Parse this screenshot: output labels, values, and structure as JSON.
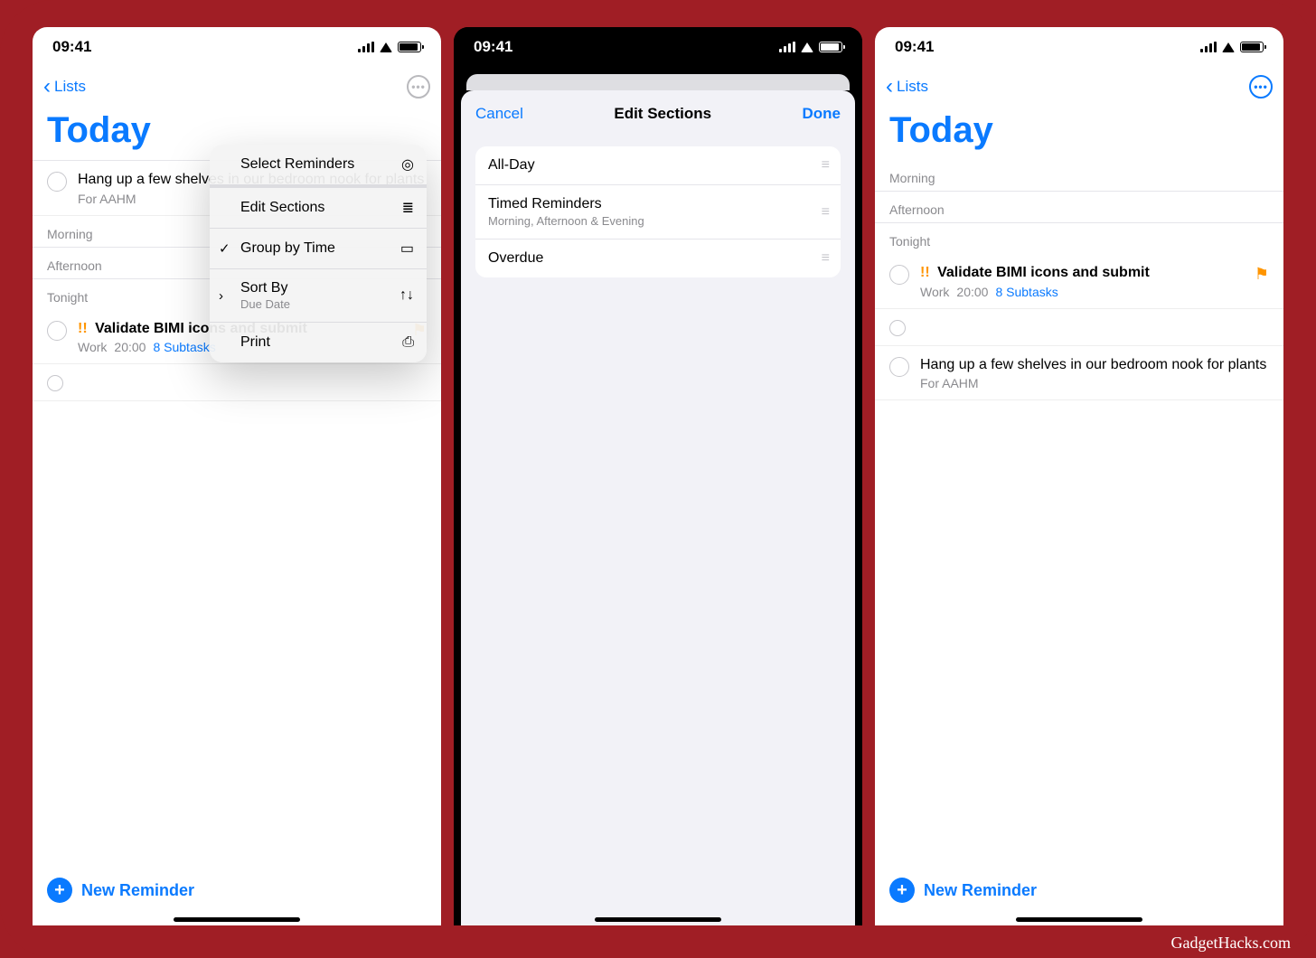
{
  "credit": "GadgetHacks.com",
  "status": {
    "time": "09:41"
  },
  "phone1": {
    "back_label": "Lists",
    "title": "Today",
    "item1": {
      "title": "Hang up a few shelves in our bedroom nook for plants",
      "title_truncated": "Hang up a few",
      "sub": "For AAHM"
    },
    "sections": {
      "morning": "Morning",
      "afternoon": "Afternoon",
      "tonight": "Tonight"
    },
    "item2": {
      "priority": "!!",
      "title": "Validate BIMI icons and submit",
      "list": "Work",
      "time": "20:00",
      "subtasks": "8 Subtasks"
    },
    "menu": {
      "select": "Select Reminders",
      "edit": "Edit Sections",
      "group": "Group by Time",
      "sort": "Sort By",
      "sort_sub": "Due Date",
      "print": "Print"
    },
    "new_reminder": "New Reminder"
  },
  "phone2": {
    "cancel": "Cancel",
    "title": "Edit Sections",
    "done": "Done",
    "rows": {
      "allday": "All-Day",
      "timed": "Timed Reminders",
      "timed_sub": "Morning, Afternoon & Evening",
      "overdue": "Overdue"
    }
  },
  "phone3": {
    "back_label": "Lists",
    "title": "Today",
    "sections": {
      "morning": "Morning",
      "afternoon": "Afternoon",
      "tonight": "Tonight"
    },
    "item1": {
      "priority": "!!",
      "title": "Validate BIMI icons and submit",
      "list": "Work",
      "time": "20:00",
      "subtasks": "8 Subtasks"
    },
    "item2": {
      "title": "Hang up a few shelves in our bedroom nook for plants",
      "sub": "For AAHM"
    },
    "new_reminder": "New Reminder"
  }
}
